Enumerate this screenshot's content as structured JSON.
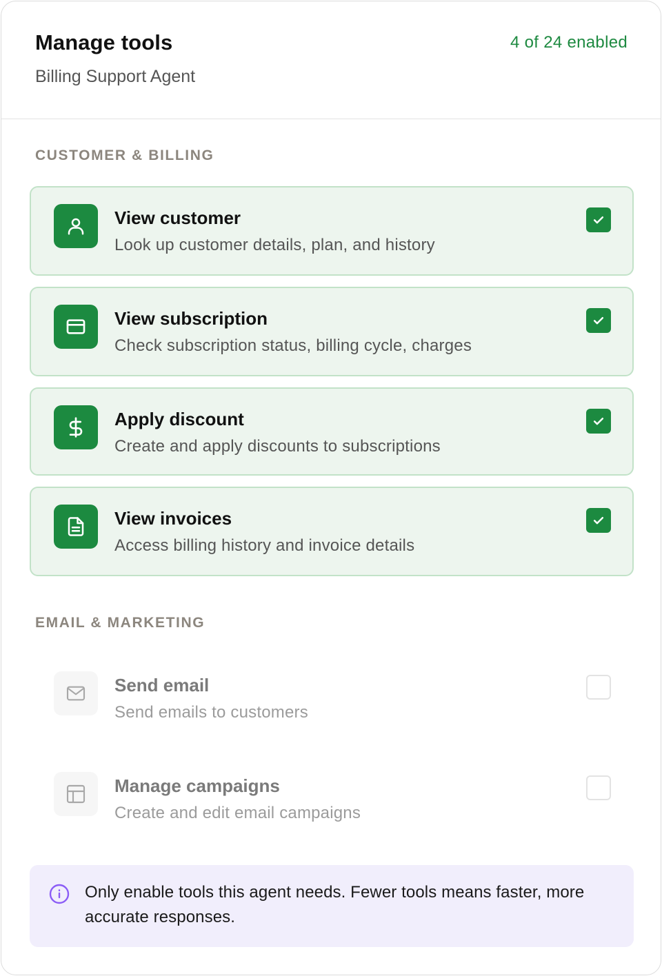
{
  "header": {
    "title": "Manage tools",
    "subtitle": "Billing Support Agent",
    "enabled_count": "4 of 24 enabled"
  },
  "sections": [
    {
      "label": "CUSTOMER & BILLING",
      "tools": [
        {
          "name": "View customer",
          "description": "Look up customer details, plan, and history",
          "icon": "user-icon",
          "enabled": true
        },
        {
          "name": "View subscription",
          "description": "Check subscription status, billing cycle, charges",
          "icon": "credit-card-icon",
          "enabled": true
        },
        {
          "name": "Apply discount",
          "description": "Create and apply discounts to subscriptions",
          "icon": "dollar-icon",
          "enabled": true
        },
        {
          "name": "View invoices",
          "description": "Access billing history and invoice details",
          "icon": "file-text-icon",
          "enabled": true
        }
      ]
    },
    {
      "label": "EMAIL & MARKETING",
      "tools": [
        {
          "name": "Send email",
          "description": "Send emails to customers",
          "icon": "mail-icon",
          "enabled": false
        },
        {
          "name": "Manage campaigns",
          "description": "Create and edit email campaigns",
          "icon": "layout-icon",
          "enabled": false
        }
      ]
    }
  ],
  "notice": {
    "icon": "info-icon",
    "text": "Only enable tools this agent needs. Fewer tools means faster, more accurate responses."
  },
  "colors": {
    "accent": "#1c8a40",
    "enabled_bg": "#edf5ee",
    "enabled_border": "#c2e2c8",
    "notice_bg": "#f1eefc",
    "notice_icon": "#8b5cf6"
  }
}
